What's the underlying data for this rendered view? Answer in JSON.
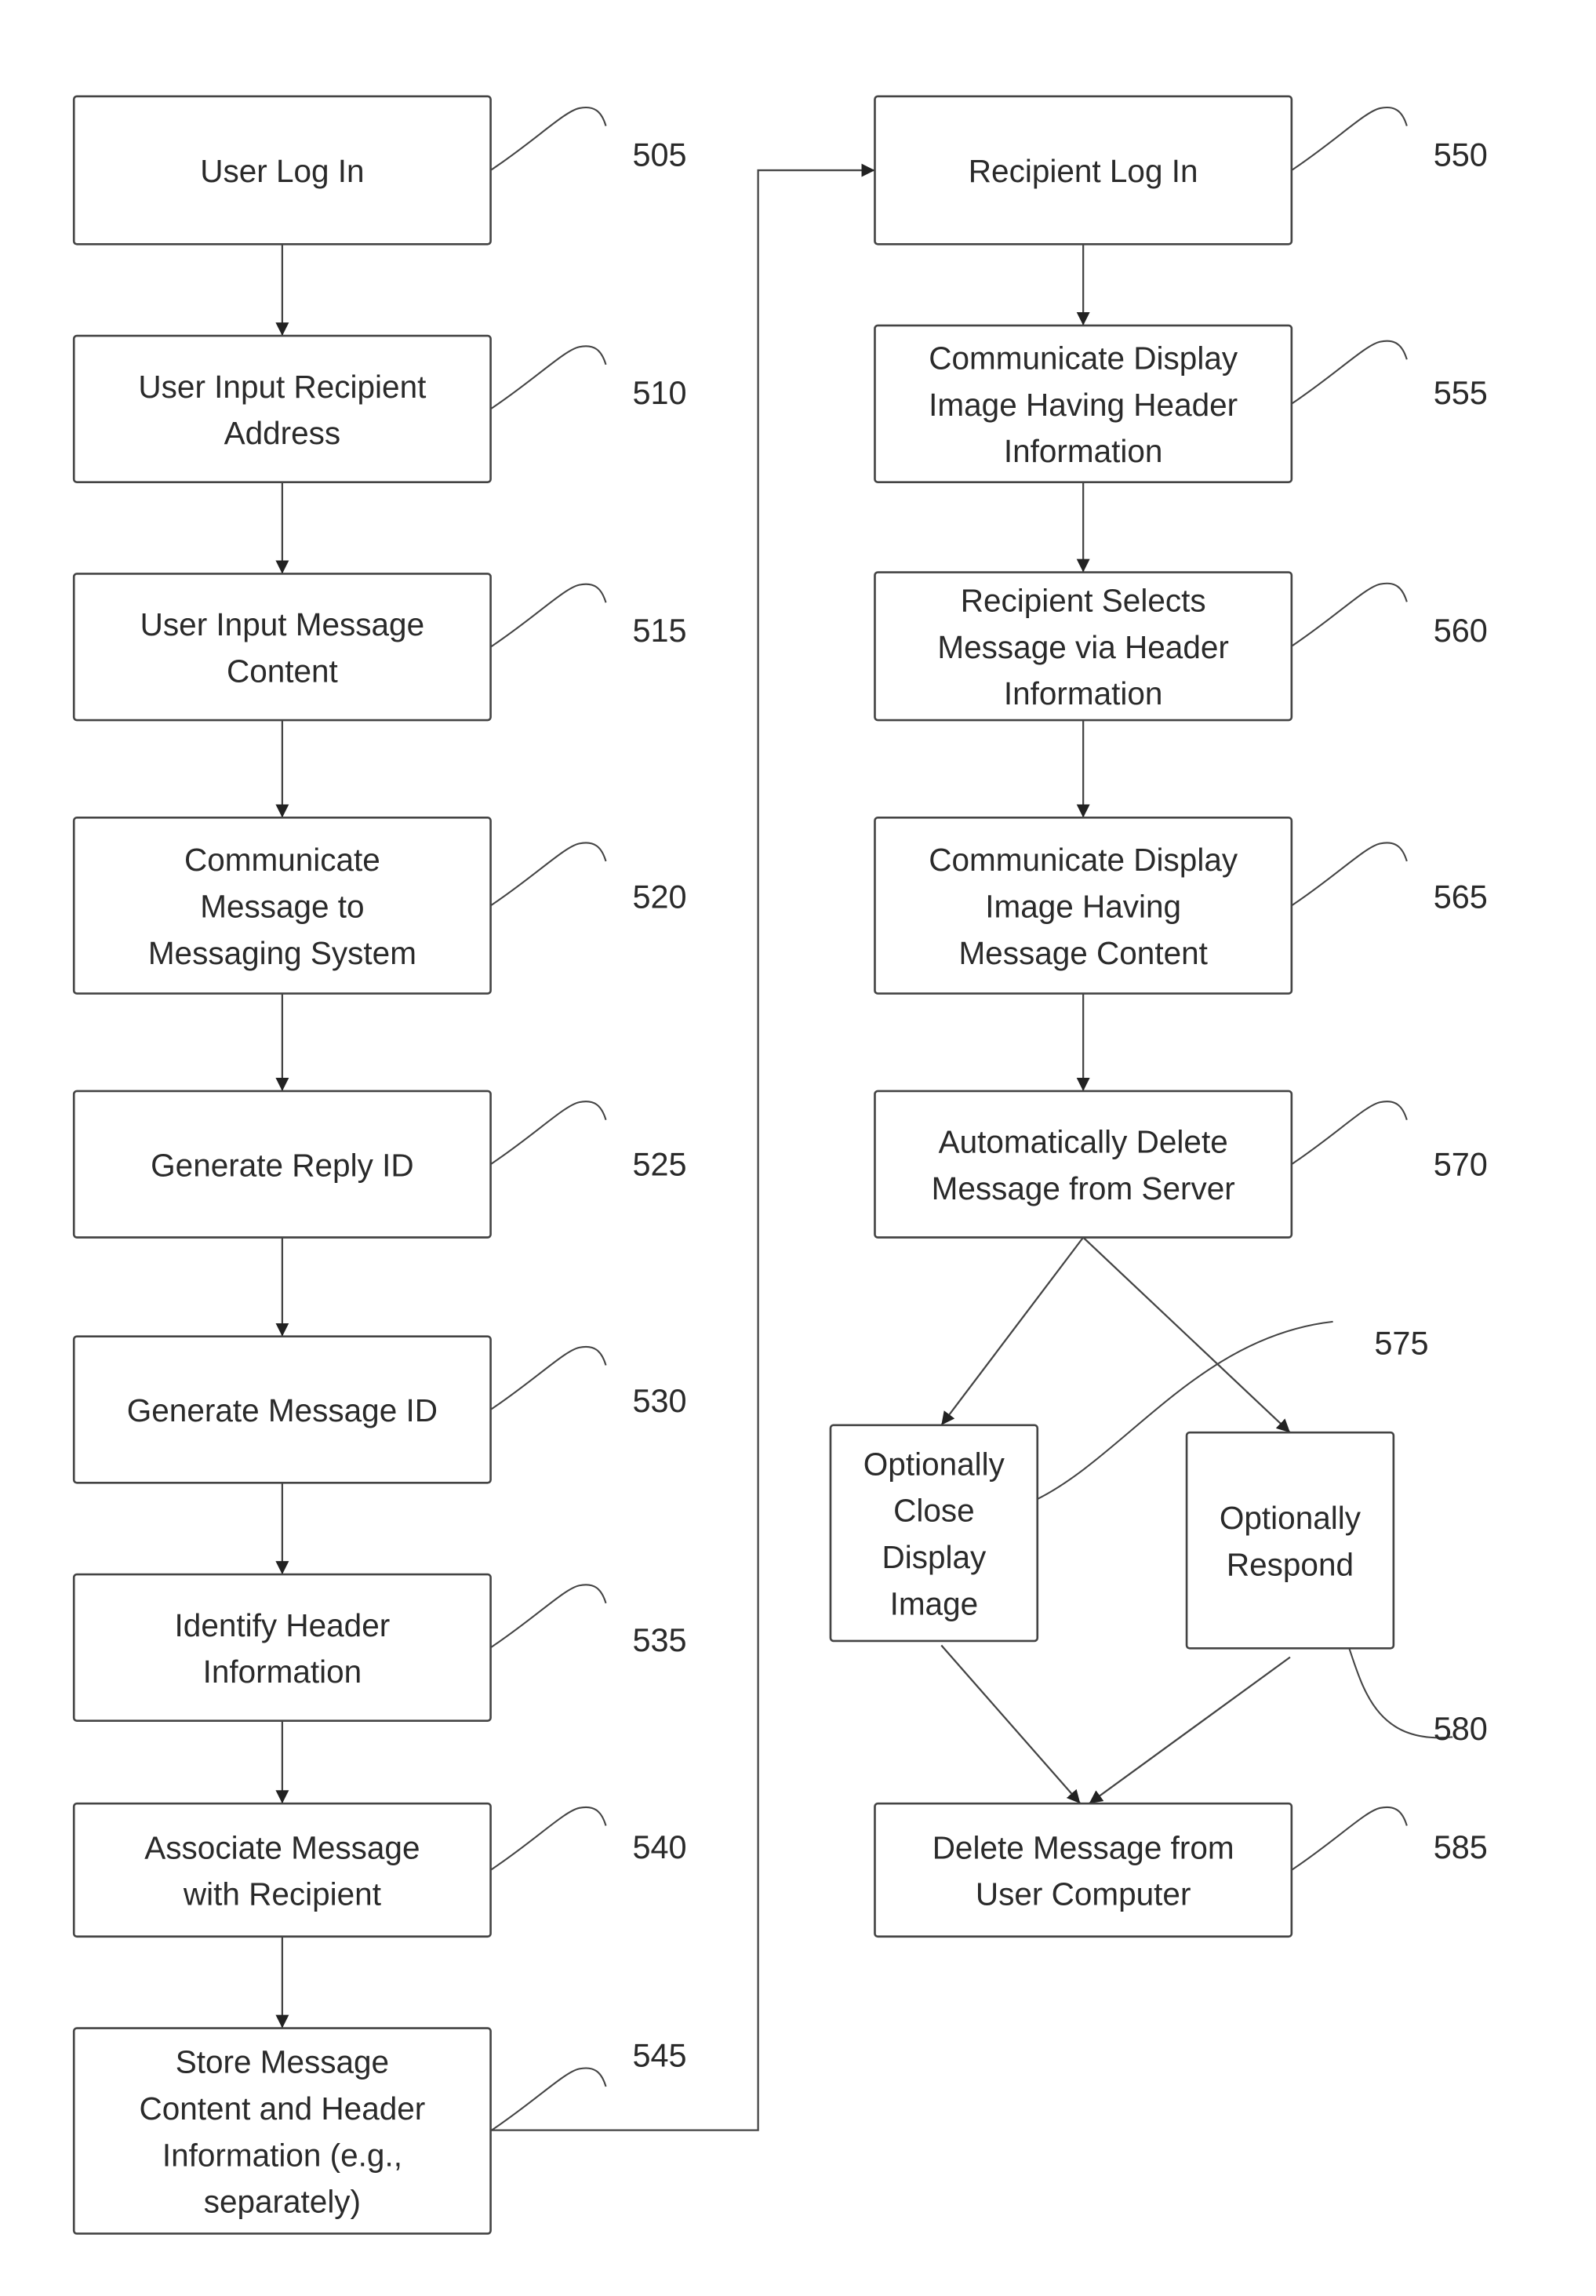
{
  "figure": {
    "type": "flowchart",
    "nodes": [
      {
        "id": "505",
        "lines": [
          "User Log In"
        ]
      },
      {
        "id": "510",
        "lines": [
          "User Input Recipient",
          "Address"
        ]
      },
      {
        "id": "515",
        "lines": [
          "User Input Message",
          "Content"
        ]
      },
      {
        "id": "520",
        "lines": [
          "Communicate",
          "Message to",
          "Messaging System"
        ]
      },
      {
        "id": "525",
        "lines": [
          "Generate Reply ID"
        ]
      },
      {
        "id": "530",
        "lines": [
          "Generate Message ID"
        ]
      },
      {
        "id": "535",
        "lines": [
          "Identify Header",
          "Information"
        ]
      },
      {
        "id": "540",
        "lines": [
          "Associate Message",
          "with Recipient"
        ]
      },
      {
        "id": "545",
        "lines": [
          "Store Message",
          "Content and Header",
          "Information (e.g.,",
          "separately)"
        ]
      },
      {
        "id": "550",
        "lines": [
          "Recipient Log In"
        ]
      },
      {
        "id": "555",
        "lines": [
          "Communicate Display",
          "Image Having Header",
          "Information"
        ]
      },
      {
        "id": "560",
        "lines": [
          "Recipient Selects",
          "Message via Header",
          "Information"
        ]
      },
      {
        "id": "565",
        "lines": [
          "Communicate Display",
          "Image Having",
          "Message Content"
        ]
      },
      {
        "id": "570",
        "lines": [
          "Automatically Delete",
          "Message from Server"
        ]
      },
      {
        "id": "575",
        "lines": [
          "Optionally",
          "Close",
          "Display",
          "Image"
        ]
      },
      {
        "id": "580",
        "lines": [
          "Optionally",
          "Respond"
        ]
      },
      {
        "id": "585",
        "lines": [
          "Delete Message from",
          "User Computer"
        ]
      }
    ],
    "edges": [
      [
        "505",
        "510"
      ],
      [
        "510",
        "515"
      ],
      [
        "515",
        "520"
      ],
      [
        "520",
        "525"
      ],
      [
        "525",
        "530"
      ],
      [
        "530",
        "535"
      ],
      [
        "535",
        "540"
      ],
      [
        "540",
        "545"
      ],
      [
        "545",
        "550"
      ],
      [
        "550",
        "555"
      ],
      [
        "555",
        "560"
      ],
      [
        "560",
        "565"
      ],
      [
        "565",
        "570"
      ],
      [
        "570",
        "575"
      ],
      [
        "570",
        "580"
      ],
      [
        "575",
        "585"
      ],
      [
        "580",
        "585"
      ]
    ]
  }
}
